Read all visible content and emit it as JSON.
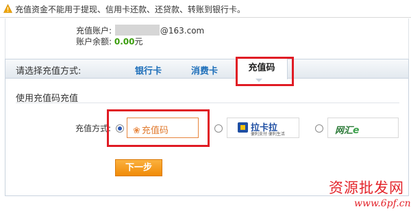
{
  "notice": {
    "icon": "warning-icon",
    "text": "充值资金不能用于提现、信用卡还款、还贷款、转账到银行卡。"
  },
  "account": {
    "account_label": "充值账户:",
    "account_suffix": "@163.com",
    "balance_label": "账户余额:",
    "balance_value": "0.00",
    "balance_unit": "元",
    "balance_color": "#3a9d0d"
  },
  "method": {
    "title": "请选择充值方式:",
    "tabs": [
      {
        "label": "银行卡"
      },
      {
        "label": "消费卡"
      },
      {
        "label": "充值码",
        "active": true
      }
    ],
    "section_title": "使用充值码充值",
    "pay_label": "充值方式:",
    "options": [
      {
        "name": "充值码",
        "icon": "coupon-icon",
        "selected": true
      },
      {
        "name": "拉卡拉",
        "subtitle": "便利支付 便利生活",
        "icon": "lakala-logo"
      },
      {
        "name": "网汇",
        "suffix": "e",
        "icon": "wanghui-logo"
      }
    ],
    "next_button": "下一步"
  },
  "watermark": {
    "text": "资源批发网",
    "url": "www.6pf.cn"
  },
  "colors": {
    "accent_link": "#1e6fba",
    "button": "#f39c12",
    "highlight": "#e01b24"
  }
}
